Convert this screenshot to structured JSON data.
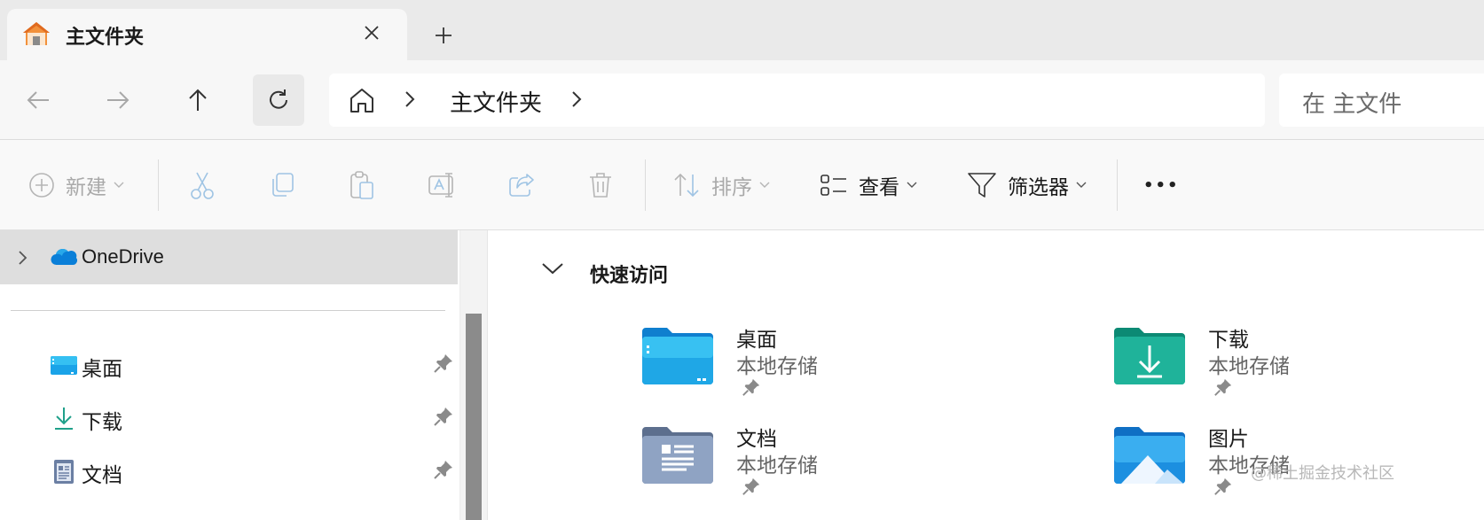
{
  "tab": {
    "title": "主文件夹"
  },
  "address": {
    "crumb": "主文件夹"
  },
  "search": {
    "placeholder": "在 主文件"
  },
  "toolbar": {
    "new_label": "新建",
    "sort_label": "排序",
    "view_label": "查看",
    "filter_label": "筛选器",
    "more_label": "•••"
  },
  "navpane": {
    "onedrive": "OneDrive",
    "items": [
      {
        "label": "桌面",
        "icon": "desktop-icon"
      },
      {
        "label": "下载",
        "icon": "download-icon"
      },
      {
        "label": "文档",
        "icon": "documents-icon"
      }
    ]
  },
  "quick_access": {
    "title": "快速访问",
    "tiles": [
      {
        "name": "桌面",
        "location": "本地存储",
        "icon": "desktop-folder-icon"
      },
      {
        "name": "下载",
        "location": "本地存储",
        "icon": "downloads-folder-icon"
      },
      {
        "name": "文档",
        "location": "本地存储",
        "icon": "documents-folder-icon"
      },
      {
        "name": "图片",
        "location": "本地存储",
        "icon": "pictures-folder-icon"
      }
    ]
  },
  "watermark": "@稀土掘金技术社区",
  "colors": {
    "accent": "#0a7fd8",
    "folder_blue": "#1aa3e8",
    "folder_green": "#1fb39a",
    "disabled": "#a9a9a9"
  }
}
